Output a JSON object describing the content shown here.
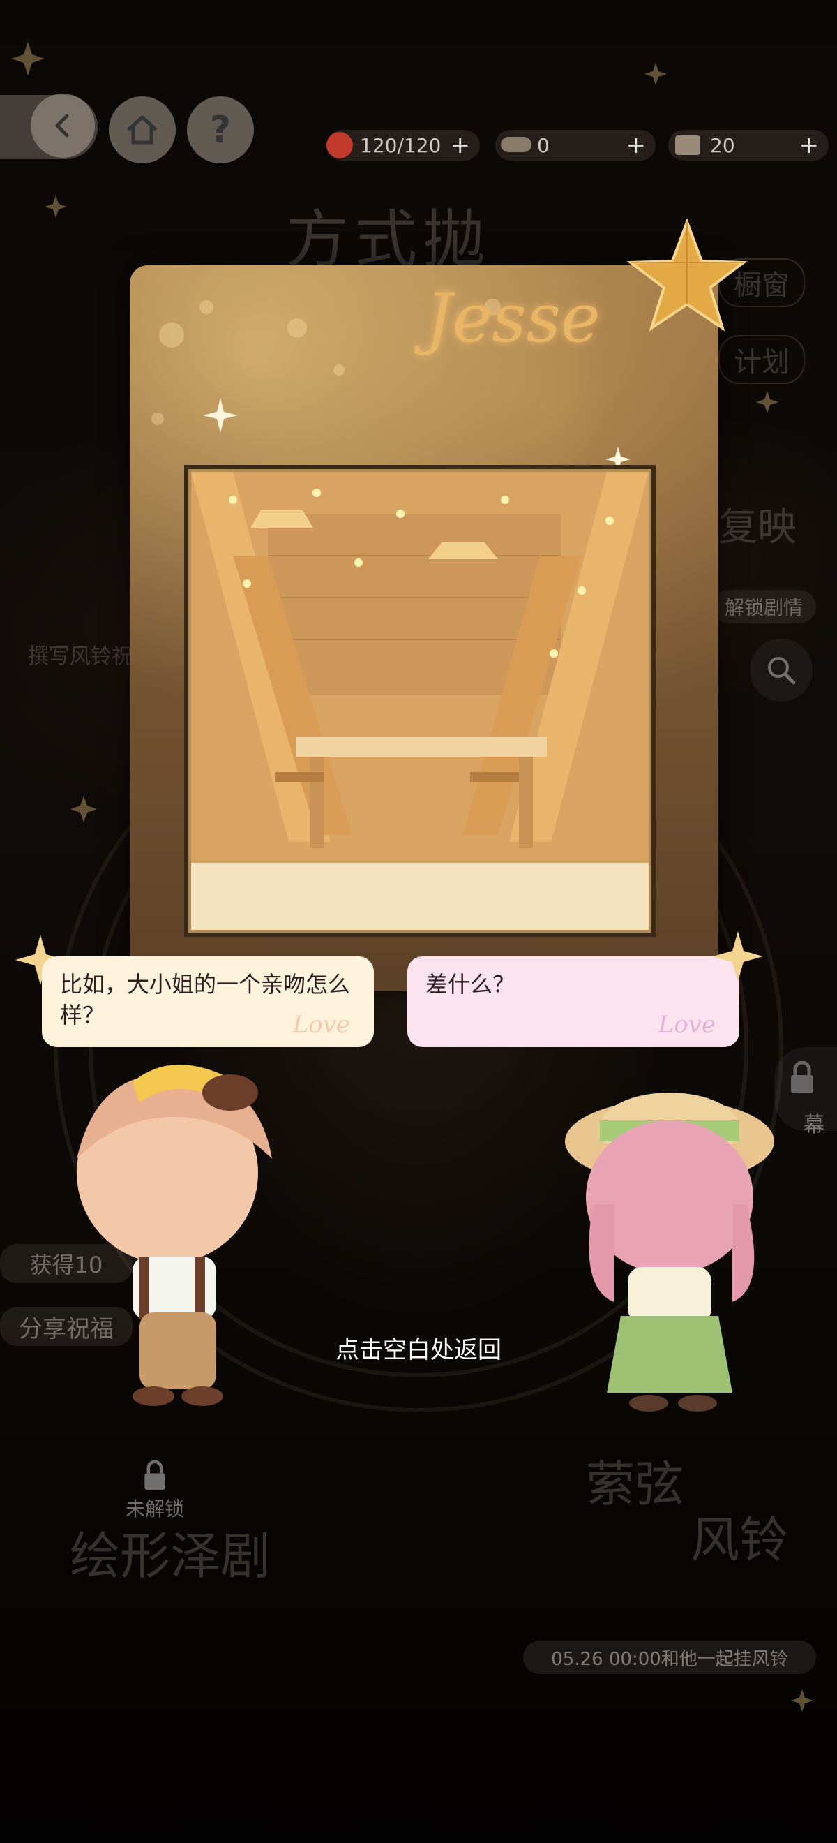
{
  "topbar": {
    "resources": [
      {
        "name": "stamina",
        "value": "120/120",
        "plus": "+"
      },
      {
        "name": "currency",
        "value": "0",
        "plus": "+"
      },
      {
        "name": "tickets",
        "value": "20",
        "plus": "+"
      }
    ]
  },
  "background": {
    "title_left_faint": "方式拋",
    "menu_right": [
      "橱窗",
      "计划"
    ],
    "replay_label": "复映",
    "unlock_story": "解锁剧情",
    "write_label": "撰写风铃祝",
    "gain_label": "获得10",
    "share_label": "分享祝福",
    "curtain_label": "幕",
    "locked_label": "未解锁",
    "bottom_left_title": "绘形泽剧",
    "bottom_right_title_1": "萦弦",
    "bottom_right_title_2": "风铃",
    "bottom_date": "05.26 00:00和他一起挂风铃"
  },
  "card": {
    "signature": "Jesse"
  },
  "dialogue": {
    "left_bubble": "比如，大小姐的一个亲吻怎么样？",
    "right_bubble": "差什么？",
    "watermark": "Love"
  },
  "hint": "点击空白处返回",
  "colors": {
    "accent_gold": "#d9a955",
    "left_bubble_bg": "#fff3dc",
    "right_bubble_bg": "#fde2f0"
  }
}
